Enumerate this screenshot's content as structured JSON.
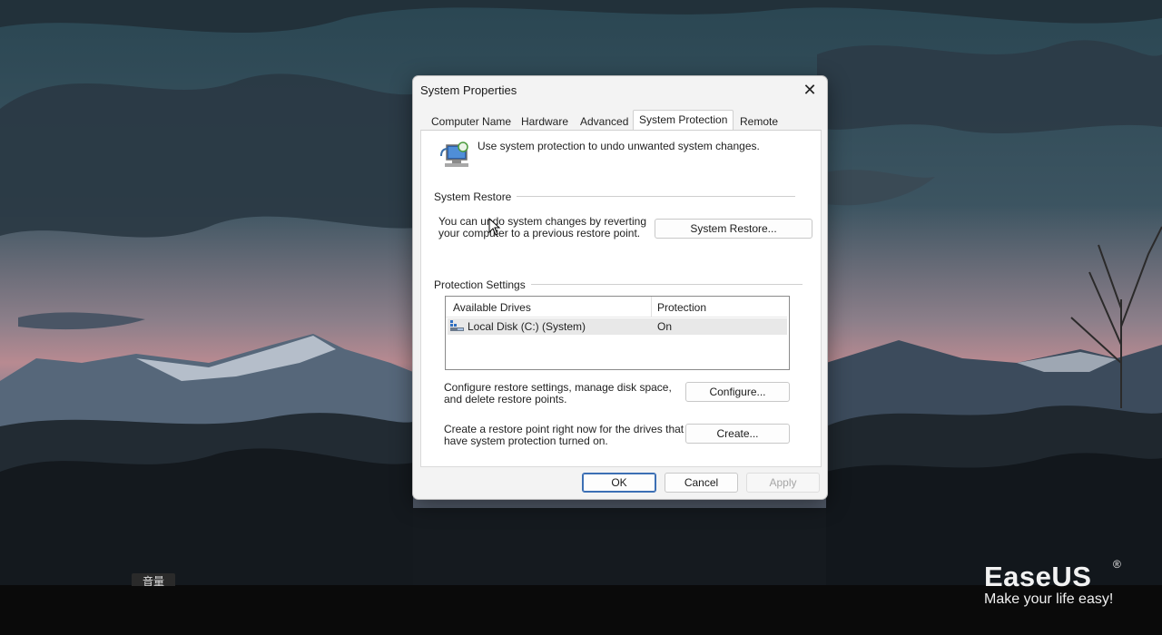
{
  "dialog": {
    "title": "System Properties",
    "tabs": [
      "Computer Name",
      "Hardware",
      "Advanced",
      "System Protection",
      "Remote"
    ],
    "active_tab": "System Protection",
    "intro": "Use system protection to undo unwanted system changes.",
    "system_restore": {
      "heading": "System Restore",
      "description_line1": "You can undo system changes by reverting",
      "description_line2": "your computer to a previous restore point.",
      "button": "System Restore..."
    },
    "protection_settings": {
      "heading": "Protection Settings",
      "columns": [
        "Available Drives",
        "Protection"
      ],
      "rows": [
        {
          "drive": "Local Disk (C:) (System)",
          "protection": "On"
        }
      ],
      "configure_text_line1": "Configure restore settings, manage disk space,",
      "configure_text_line2": "and delete restore points.",
      "configure_button": "Configure...",
      "create_text_line1": "Create a restore point right now for the drives that",
      "create_text_line2": "have system protection turned on.",
      "create_button": "Create..."
    },
    "footer": {
      "ok": "OK",
      "cancel": "Cancel",
      "apply": "Apply"
    }
  },
  "overlay": {
    "volume_tag": "音量",
    "brand_name": "EaseUS",
    "brand_mark": "®",
    "brand_slogan": "Make your life easy!"
  }
}
